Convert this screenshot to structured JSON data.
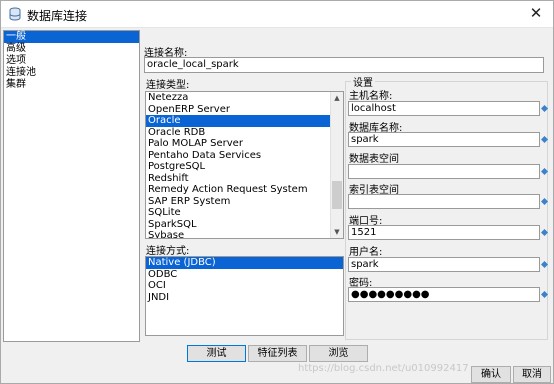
{
  "window": {
    "title": "数据库连接",
    "close_glyph": "✕"
  },
  "nav": {
    "items": [
      "一般",
      "高级",
      "选项",
      "连接池",
      "集群"
    ],
    "selected_index": 0
  },
  "connection_name": {
    "label": "连接名称:",
    "value": "oracle_local_spark"
  },
  "connection_type": {
    "label": "连接类型:",
    "items": [
      "Netezza",
      "OpenERP Server",
      "Oracle",
      "Oracle RDB",
      "Palo MOLAP Server",
      "Pentaho Data Services",
      "PostgreSQL",
      "Redshift",
      "Remedy Action Request System",
      "SAP ERP System",
      "SQLite",
      "SparkSQL",
      "Sybase"
    ],
    "selected": "Oracle"
  },
  "access_method": {
    "label": "连接方式:",
    "items": [
      "Native (JDBC)",
      "ODBC",
      "OCI",
      "JNDI"
    ],
    "selected": "Native (JDBC)"
  },
  "settings": {
    "title": "设置",
    "host_label": "主机名称:",
    "host_value": "localhost",
    "db_label": "数据库名称:",
    "db_value": "spark",
    "tablespace_data_label": "数据表空间",
    "tablespace_data_value": "",
    "tablespace_index_label": "索引表空间",
    "tablespace_index_value": "",
    "port_label": "端口号:",
    "port_value": "1521",
    "user_label": "用户名:",
    "user_value": "spark",
    "password_label": "密码:",
    "password_value": "●●●●●●●●●"
  },
  "buttons": {
    "test": "测试",
    "features": "特征列表",
    "explore": "浏览",
    "ok": "确认",
    "cancel": "取消"
  },
  "watermark": "https://blog.csdn.net/u010992417",
  "colors": {
    "selection": "#0a64d4",
    "variable_icon": "#3c82c8"
  }
}
